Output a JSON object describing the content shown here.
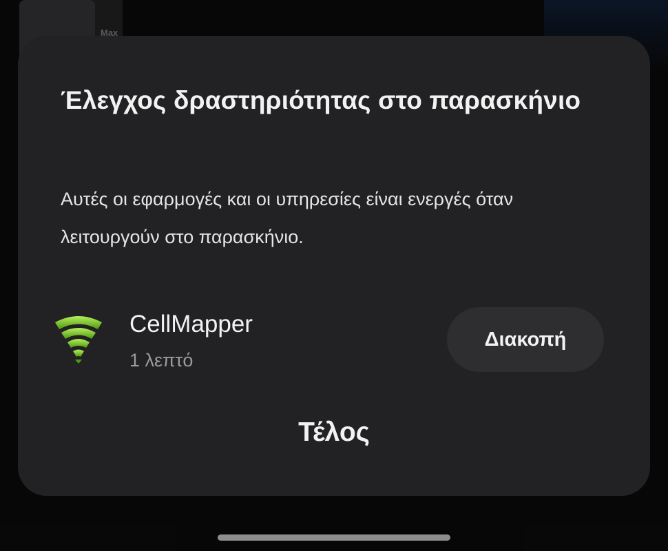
{
  "background": {
    "fragment_text": "Max"
  },
  "dialog": {
    "title": "Έλεγχος δραστηριότητας στο παρασκήνιο",
    "description": "Αυτές οι εφαρμογές και οι υπηρεσίες είναι ενεργές όταν λειτουργούν στο παρασκήνιο.",
    "apps": [
      {
        "name": "CellMapper",
        "duration": "1 λεπτό",
        "icon": "cellmapper-signal-icon",
        "action_label": "Διακοπή"
      }
    ],
    "done_label": "Τέλος"
  },
  "colors": {
    "sheet_bg": "#222224",
    "button_bg": "#2e2e30",
    "icon_green": "#8fd13a"
  }
}
